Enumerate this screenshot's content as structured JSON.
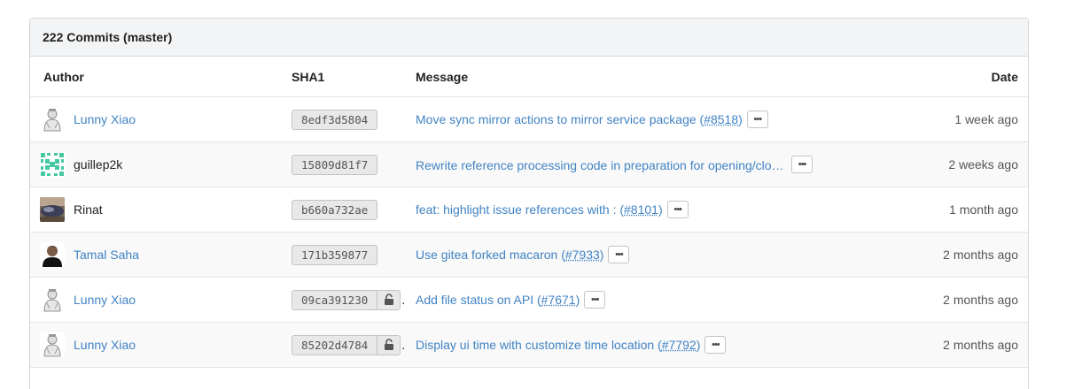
{
  "panel": {
    "title": "222 Commits (master)"
  },
  "columns": {
    "author": "Author",
    "sha": "SHA1",
    "message": "Message",
    "date": "Date"
  },
  "ellipsis_label": "•••",
  "colors": {
    "link": "#4183c4",
    "header_bg": "#f3f4f5",
    "sha_bg": "#e8e8e8"
  },
  "commits": [
    {
      "author": "Lunny Xiao",
      "author_linked": true,
      "avatar": "lunny-avatar",
      "sha": "8edf3d5804",
      "signed": false,
      "message": "Move sync mirror actions to mirror service package (",
      "issue": "#8518",
      "message_suffix": ")",
      "date": "1 week ago"
    },
    {
      "author": "guillep2k",
      "author_linked": false,
      "avatar": "identicon-avatar",
      "sha": "15809d81f7",
      "signed": false,
      "message": "Rewrite reference processing code in preparation for opening/closi…",
      "issue": "",
      "message_suffix": "",
      "date": "2 weeks ago"
    },
    {
      "author": "Rinat",
      "author_linked": false,
      "avatar": "photo-avatar",
      "sha": "b660a732ae",
      "signed": false,
      "message": "feat: highlight issue references with : (",
      "issue": "#8101",
      "message_suffix": ")",
      "date": "1 month ago"
    },
    {
      "author": "Tamal Saha",
      "author_linked": true,
      "avatar": "person-avatar",
      "sha": "171b359877",
      "signed": false,
      "message": "Use gitea forked macaron (",
      "issue": "#7933",
      "message_suffix": ")",
      "date": "2 months ago"
    },
    {
      "author": "Lunny Xiao",
      "author_linked": true,
      "avatar": "lunny-avatar",
      "sha": "09ca391230",
      "signed": true,
      "message": "Add file status on API (",
      "issue": "#7671",
      "message_suffix": ")",
      "date": "2 months ago"
    },
    {
      "author": "Lunny Xiao",
      "author_linked": true,
      "avatar": "lunny-avatar",
      "sha": "85202d4784",
      "signed": true,
      "message": "Display ui time with customize time location (",
      "issue": "#7792",
      "message_suffix": ")",
      "date": "2 months ago"
    }
  ]
}
